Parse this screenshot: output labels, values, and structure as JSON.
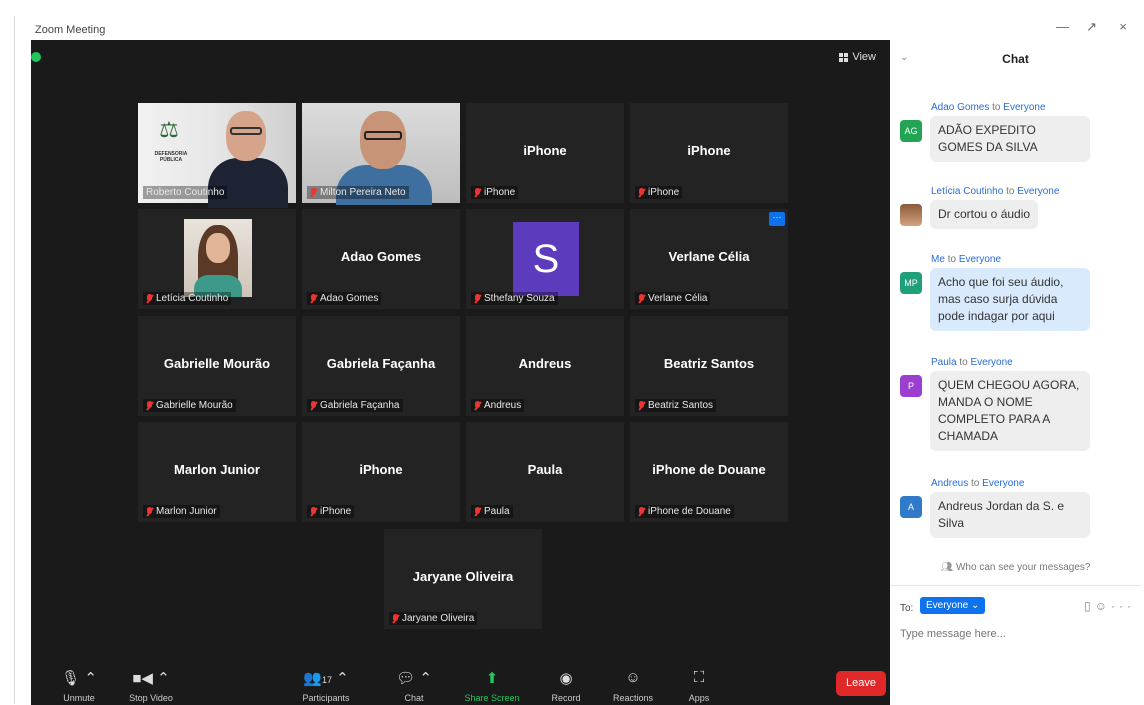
{
  "window": {
    "title": "Zoom Meeting",
    "controls": [
      "—",
      "↗",
      "×"
    ]
  },
  "meeting": {
    "view_label": "View",
    "tiles": [
      {
        "name": "",
        "label": "Roberto Coutinho",
        "kind": "photo1",
        "logo_text": "DEFENSORIA PÚBLICA"
      },
      {
        "name": "",
        "label": "Milton Pereira Neto",
        "kind": "photo2"
      },
      {
        "name": "iPhone",
        "label": "iPhone"
      },
      {
        "name": "iPhone",
        "label": "iPhone"
      },
      {
        "name": "",
        "label": "Letícia Coutinho",
        "kind": "photo3"
      },
      {
        "name": "Adao Gomes",
        "label": "Adao Gomes"
      },
      {
        "name": "",
        "label": "Sthefany Souza",
        "kind": "avatar",
        "initial": "S"
      },
      {
        "name": "Verlane Célia",
        "label": "Verlane Célia"
      },
      {
        "name": "Gabrielle Mourão",
        "label": "Gabrielle Mourão"
      },
      {
        "name": "Gabriela Façanha",
        "label": "Gabriela Façanha"
      },
      {
        "name": "Andreus",
        "label": "Andreus"
      },
      {
        "name": "Beatriz Santos",
        "label": "Beatriz Santos"
      },
      {
        "name": "Marlon Junior",
        "label": "Marlon Junior"
      },
      {
        "name": "iPhone",
        "label": "iPhone"
      },
      {
        "name": "Paula",
        "label": "Paula"
      },
      {
        "name": "iPhone de Douane",
        "label": "iPhone de Douane"
      },
      {
        "name": "Jaryane Oliveira",
        "label": "Jaryane Oliveira"
      }
    ]
  },
  "toolbar": {
    "unmute": "Unmute",
    "stop_video": "Stop Video",
    "participants": "Participants",
    "participants_count": "17",
    "chat": "Chat",
    "share_screen": "Share Screen",
    "record": "Record",
    "reactions": "Reactions",
    "apps": "Apps",
    "leave": "Leave"
  },
  "chat": {
    "title": "Chat",
    "messages": [
      {
        "from": "Adao Gomes",
        "to_word": "to",
        "to": "Everyone",
        "initials": "AG",
        "color": "#23a455",
        "text": "ADÃO EXPEDITO GOMES DA SILVA"
      },
      {
        "from": "Letícia Coutinho",
        "to_word": "to",
        "to": "Everyone",
        "initials": "",
        "color": "#b07a55",
        "text": "Dr cortou o áudio"
      },
      {
        "from": "Me",
        "to_word": "to",
        "to": "Everyone",
        "initials": "MP",
        "color": "#1fa07a",
        "text": "Acho que foi seu áudio, mas caso surja dúvida pode indagar por aqui"
      },
      {
        "from": "Paula",
        "to_word": "to",
        "to": "Everyone",
        "initials": "P",
        "color": "#9b3fd1",
        "text": "QUEM CHEGOU AGORA, MANDA O NOME COMPLETO PARA A CHAMADA"
      },
      {
        "from": "Andreus",
        "to_word": "to",
        "to": "Everyone",
        "initials": "A",
        "color": "#2f7bc9",
        "text": "Andreus Jordan da S. e Silva"
      }
    ],
    "who_can_see": "Who can see your messages?",
    "to_label": "To:",
    "to_value": "Everyone ⌄",
    "input_placeholder": "Type message here..."
  }
}
